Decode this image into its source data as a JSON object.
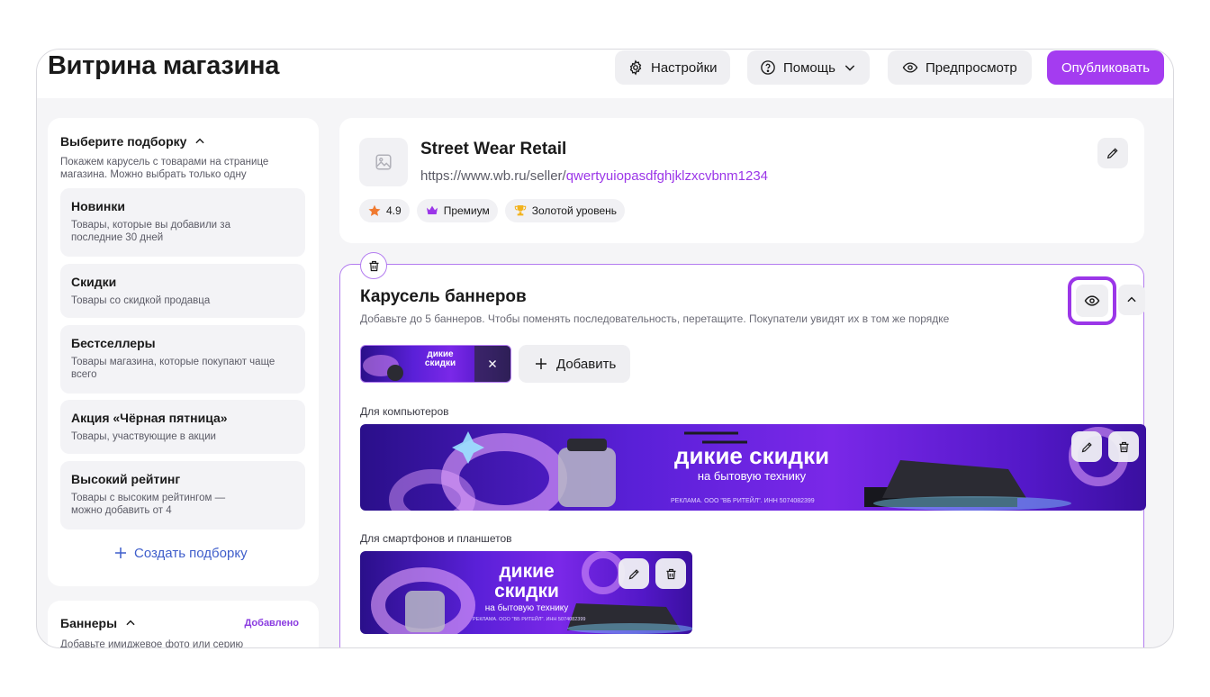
{
  "header": {
    "title": "Витрина магазина",
    "settings_label": "Настройки",
    "help_label": "Помощь",
    "preview_label": "Предпросмотр",
    "publish_label": "Опубликовать"
  },
  "sidebar": {
    "heading": "Выберите подборку",
    "description": "Покажем карусель с товарами на странице магазина. Можно выбрать только одну",
    "items": [
      {
        "title": "Новинки",
        "description": "Товары, которые вы добавили за последние 30 дней"
      },
      {
        "title": "Скидки",
        "description": "Товары со скидкой продавца"
      },
      {
        "title": "Бестселлеры",
        "description": "Товары магазина, которые покупают чаще всего"
      },
      {
        "title": "Акция «Чёрная пятница»",
        "description": "Товары, участвующие в акции"
      },
      {
        "title": "Высокий рейтинг",
        "description": "Товары с высоким рейтингом — можно добавить от 4"
      }
    ],
    "create_label": "Создать подборку",
    "banners": {
      "heading": "Баннеры",
      "status": "Добавлено",
      "description": "Добавьте имиджевое фото или серию"
    }
  },
  "store": {
    "name": "Street Wear Retail",
    "url_prefix": "https://www.wb.ru/seller/",
    "url_slug": "qwertyuiopasdfghjklzxcvbnm1234",
    "rating": "4.9",
    "premium_label": "Премиум",
    "level_label": "Золотой уровень"
  },
  "carousel": {
    "title": "Карусель баннеров",
    "description": "Добавьте до 5 баннеров. Чтобы поменять последовательность, перетащите. Покупатели увидят их в том же порядке",
    "add_label": "Добавить",
    "desktop_label": "Для компьютеров",
    "mobile_label": "Для смартфонов и планшетов",
    "banner": {
      "headline_line1": "дикие",
      "headline_line2": "скидки",
      "headline_full": "дикие скидки",
      "subline": "на бытовую технику",
      "legal": "РЕКЛАМА. ООО \"ВБ РИТЕЙЛ\". ИНН 5074082399"
    }
  },
  "colors": {
    "accent": "#a43cf0",
    "link": "#3f5ecb",
    "highlight": "#9b36e8"
  }
}
